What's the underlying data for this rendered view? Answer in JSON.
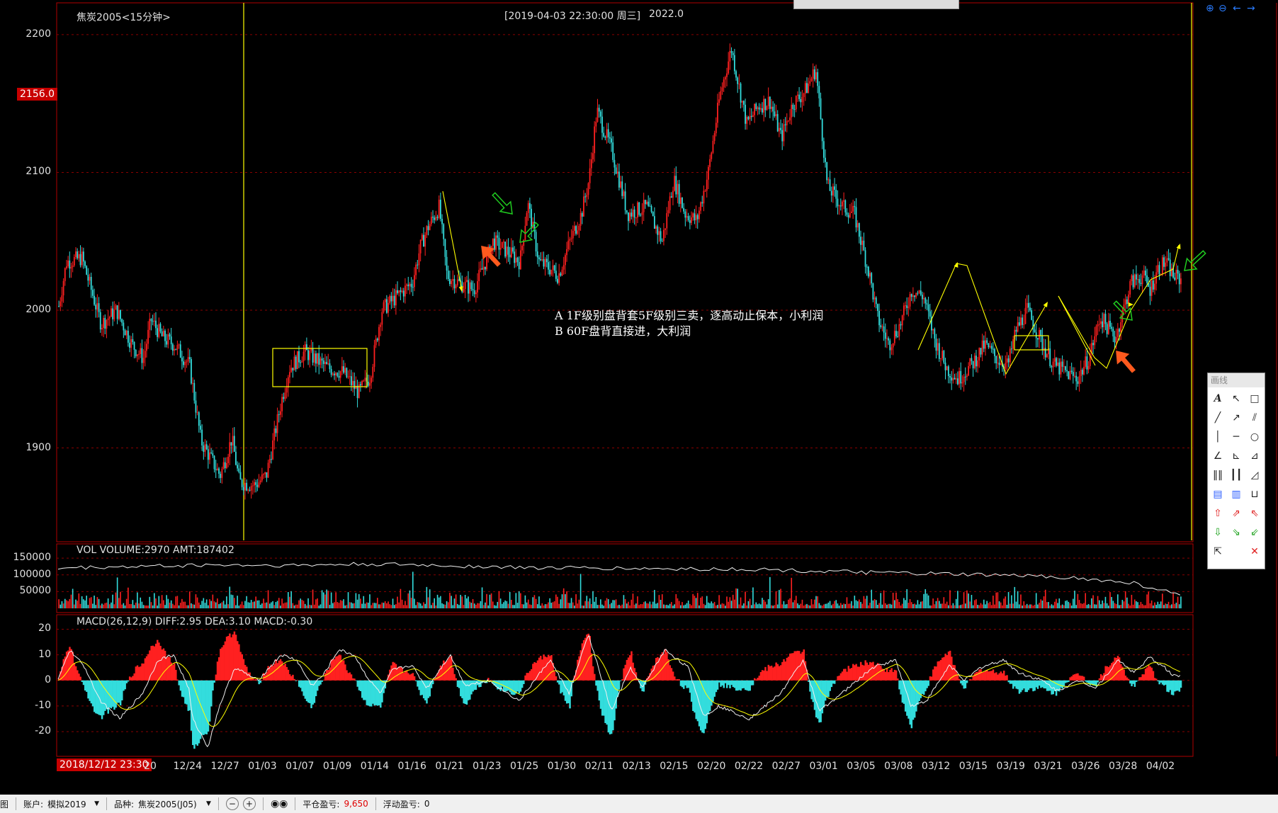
{
  "header": {
    "title": "焦炭2005<15分钟>",
    "cursor_info": "[2019-04-03  22:30:00 周三]",
    "cursor_price": "2022.0",
    "price_marker": "2156.0"
  },
  "annotations": {
    "line_a": "A 1F级别盘背套5F级别三卖，逐高动止保本，小利润",
    "line_b": "B 60F盘背直接进，大利润"
  },
  "volume_panel": {
    "label": "VOL  VOLUME:2970 AMT:187402"
  },
  "macd_panel": {
    "label": "MACD(26,12,9)  DIFF:2.95 DEA:3.10 MACD:-0.30"
  },
  "cursor_date_label": "2018/12/12 23:30",
  "toolbox": {
    "title": "画线"
  },
  "statusbar": {
    "left_stub": "图",
    "account_label": "账户:",
    "account_value": "模拟2019",
    "symbol_label": "品种:",
    "symbol_value": "焦炭2005(J05)",
    "closed_pnl_label": "平仓盈亏:",
    "closed_pnl_value": "9,650",
    "float_pnl_label": "浮动盈亏:",
    "float_pnl_value": "0"
  },
  "colors": {
    "up": "#ff2020",
    "down": "#33dddd",
    "frame": "#b00000",
    "yellow": "#ffff00",
    "green": "#20cc20",
    "orange": "#ff5a1e",
    "price_marker_bg": "#c80000"
  },
  "chart_data": [
    {
      "type": "candlestick",
      "title": "焦炭2005<15分钟>",
      "ylim": [
        1835,
        2220
      ],
      "yticks": [
        1900,
        2000,
        2100,
        2200
      ],
      "xticks": [
        "20",
        "12/24",
        "12/27",
        "01/03",
        "01/07",
        "01/09",
        "01/14",
        "01/16",
        "01/21",
        "01/23",
        "01/25",
        "01/30",
        "02/11",
        "02/13",
        "02/15",
        "02/20",
        "02/22",
        "02/27",
        "03/01",
        "03/05",
        "03/08",
        "03/12",
        "03/15",
        "03/19",
        "03/21",
        "03/26",
        "03/28",
        "04/02"
      ],
      "close_path": {
        "x": [
          0,
          10,
          30,
          55,
          75,
          95,
          110,
          120,
          135,
          150,
          170,
          185,
          200,
          210,
          225,
          235,
          255,
          270,
          290,
          300,
          320,
          350,
          370,
          390,
          405,
          420,
          440,
          460,
          470,
          480,
          495,
          505,
          520,
          540,
          555,
          565,
          590,
          600,
          610,
          625,
          640,
          650,
          665,
          680,
          690,
          700,
          720,
          740,
          765,
          785,
          800,
          815,
          830,
          845,
          860,
          875,
          895,
          910,
          925,
          940,
          955,
          970,
          985,
          1000,
          1020,
          1035,
          1055,
          1065,
          1080,
          1095,
          1110,
          1125,
          1140,
          1155,
          1170,
          1190,
          1205,
          1220,
          1235,
          1245,
          1260,
          1280,
          1295,
          1310,
          1325,
          1340,
          1355,
          1375,
          1385,
          1395,
          1410,
          1420,
          1430,
          1440,
          1450,
          1460
        ],
        "y": [
          2003,
          2035,
          2038,
          1990,
          2000,
          1975,
          1965,
          1993,
          1980,
          1975,
          1960,
          1905,
          1890,
          1880,
          1907,
          1875,
          1873,
          1880,
          1935,
          1958,
          1970,
          1958,
          1955,
          1940,
          1952,
          2000,
          2010,
          2020,
          2045,
          2060,
          2075,
          2025,
          2020,
          2015,
          2035,
          2050,
          2040,
          2035,
          2078,
          2035,
          2030,
          2025,
          2050,
          2070,
          2095,
          2145,
          2115,
          2070,
          2075,
          2050,
          2095,
          2070,
          2065,
          2100,
          2155,
          2190,
          2135,
          2148,
          2152,
          2125,
          2150,
          2158,
          2175,
          2090,
          2075,
          2070,
          2025,
          1995,
          1975,
          1990,
          2015,
          2010,
          1978,
          1958,
          1950,
          1962,
          1975,
          1965,
          1960,
          1985,
          2000,
          1975,
          1960,
          1955,
          1950,
          1965,
          1995,
          1980,
          2000,
          2020,
          2025,
          2015,
          2030,
          2035,
          2025,
          2022
        ]
      }
    },
    {
      "type": "bar",
      "title": "VOL  VOLUME:2970 AMT:187402",
      "ylim": [
        0,
        180000
      ],
      "yticks": [
        50000,
        100000,
        150000
      ],
      "ma_path": {
        "x": [
          0,
          100,
          200,
          300,
          400,
          500,
          600,
          700,
          800,
          900,
          1000,
          1100,
          1200,
          1300,
          1400,
          1460
        ],
        "y": [
          120000,
          125000,
          130000,
          128000,
          132000,
          128000,
          122000,
          120000,
          118000,
          117000,
          110000,
          105000,
          100000,
          95000,
          75000,
          40000
        ]
      }
    },
    {
      "type": "bar",
      "title": "MACD(26,12,9)  DIFF:2.95 DEA:3.10 MACD:-0.30",
      "ylim": [
        -28,
        24
      ],
      "yticks": [
        20,
        10,
        0,
        -10,
        -20
      ],
      "diff_path": {
        "x": [
          0,
          15,
          35,
          55,
          80,
          110,
          130,
          150,
          170,
          175,
          195,
          210,
          230,
          260,
          290,
          310,
          330,
          345,
          365,
          385,
          405,
          420,
          435,
          460,
          480,
          510,
          530,
          560,
          600,
          640,
          665,
          690,
          720,
          745,
          760,
          790,
          820,
          840,
          860,
          900,
          940,
          970,
          990,
          1020,
          1040,
          1060,
          1090,
          1110,
          1130,
          1160,
          1180,
          1200,
          1230,
          1250,
          1280,
          1300,
          1330,
          1350,
          1380,
          1400,
          1420,
          1440,
          1450
        ],
        "y": [
          0,
          12,
          5,
          -8,
          -15,
          -5,
          8,
          10,
          -3,
          -15,
          -26,
          -10,
          5,
          0,
          10,
          8,
          -2,
          2,
          12,
          10,
          0,
          -5,
          4,
          6,
          -3,
          10,
          -2,
          0,
          -8,
          8,
          -5,
          18,
          -12,
          5,
          -3,
          12,
          5,
          -14,
          -10,
          -15,
          -5,
          8,
          -12,
          -5,
          0,
          5,
          8,
          -10,
          -8,
          6,
          0,
          5,
          8,
          3,
          0,
          -4,
          0,
          -3,
          8,
          3,
          9,
          5,
          2
        ]
      }
    }
  ]
}
